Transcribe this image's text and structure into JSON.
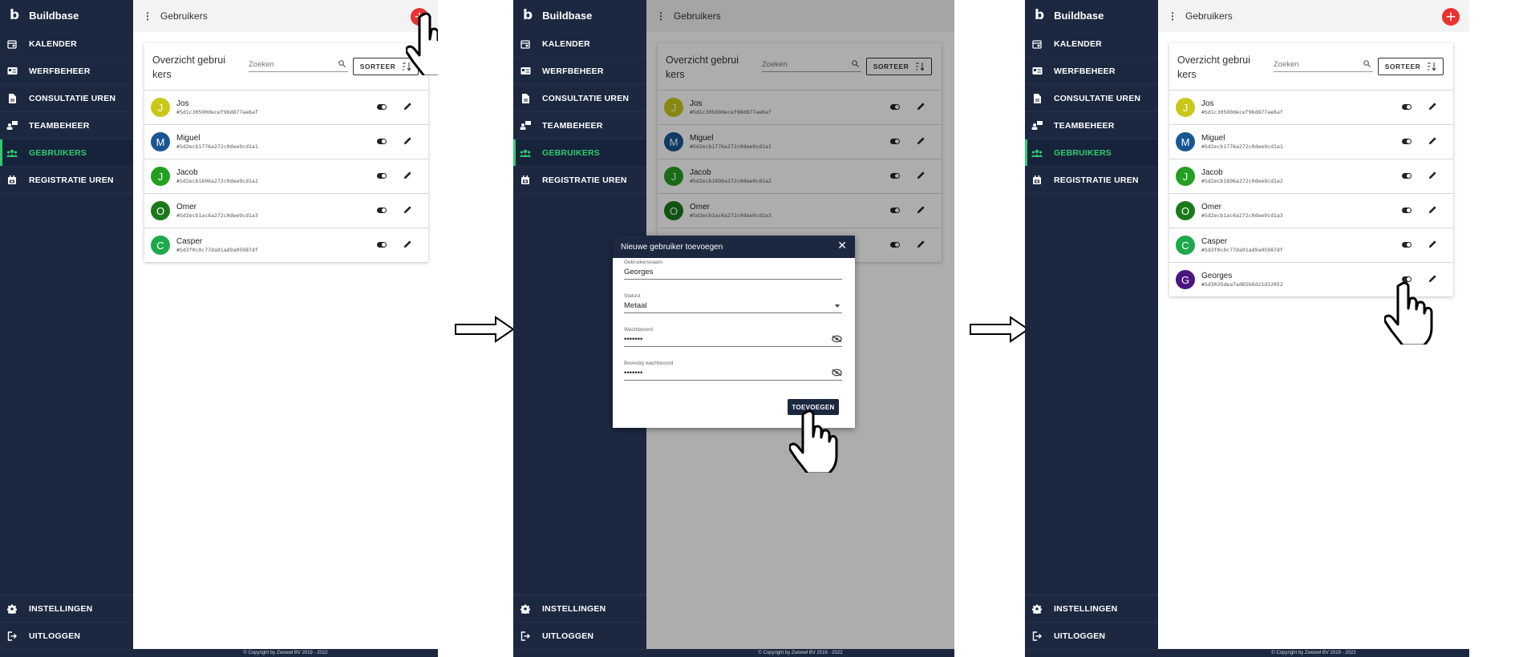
{
  "app": {
    "logo": "b",
    "name": "Buildbase"
  },
  "nav": {
    "items": [
      {
        "label": "KALENDER",
        "icon": "calendar-icon"
      },
      {
        "label": "WERFBEHEER",
        "icon": "site-card-icon"
      },
      {
        "label": "CONSULTATIE UREN",
        "icon": "document-icon"
      },
      {
        "label": "TEAMBEHEER",
        "icon": "team-manage-icon"
      },
      {
        "label": "GEBRUIKERS",
        "icon": "users-icon"
      },
      {
        "label": "REGISTRATIE UREN",
        "icon": "calendar-register-icon"
      }
    ],
    "active": "GEBRUIKERS",
    "bottom": [
      {
        "label": "INSTELLINGEN",
        "icon": "gear-icon"
      },
      {
        "label": "UITLOGGEN",
        "icon": "logout-icon"
      }
    ]
  },
  "topbar": {
    "title": "Gebruikers",
    "add_label": "+"
  },
  "card": {
    "title": "Overzicht gebruikers",
    "search_placeholder": "Zoeken",
    "sort_label": "SORTEER"
  },
  "users": [
    {
      "initial": "J",
      "name": "Jos",
      "id": "#Sd1c30590decef96d877ae6af",
      "color": "#c8c81a"
    },
    {
      "initial": "M",
      "name": "Miguel",
      "id": "#Sd2ecb1776a272c0dee9cd1a1",
      "color": "#1a5694"
    },
    {
      "initial": "J",
      "name": "Jacob",
      "id": "#Sd2ecb1896a272c0dee9cd1a2",
      "color": "#22a020"
    },
    {
      "initial": "O",
      "name": "Omer",
      "id": "#Sd2ecb1ac6a272c0dee9cd1a3",
      "color": "#1a7a1a"
    },
    {
      "initial": "C",
      "name": "Casper",
      "id": "#Sd3f0c0c77da91ad9a05987df",
      "color": "#1ea84c"
    }
  ],
  "new_user": {
    "initial": "G",
    "name": "Georges",
    "id": "#Sd3035dea7ad65b6d21d32052",
    "color": "#4a1580"
  },
  "dialog": {
    "title": "Nieuwe gebruiker toevoegen",
    "close": "✕",
    "username_label": "Gebruikersnaam",
    "username_value": "Georges",
    "status_label": "Statuut",
    "status_value": "Metaal",
    "password_label": "Wachtwoord",
    "password_value": "•••••••",
    "confirm_label": "Bevestig wachtwoord",
    "confirm_value": "•••••••",
    "submit_label": "TOEVOEGEN"
  },
  "footer": "© Copyright by Zwoewl BV 2019 - 2022"
}
